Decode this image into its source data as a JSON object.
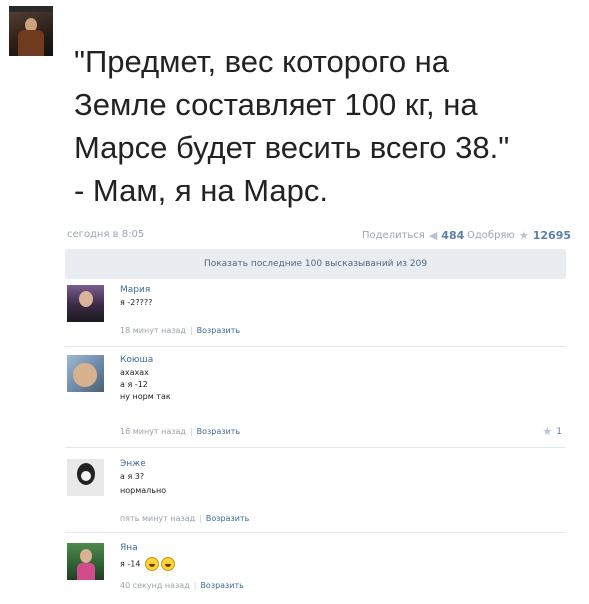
{
  "post": {
    "lines": [
      "\"Предмет, вес которого на",
      "Земле составляет 100 кг, на",
      "Марсе будет весить всего 38.\"",
      "- Мам, я на Марс."
    ],
    "date": "сегодня в 8:05",
    "share_label": "Поделиться",
    "share_count": "484",
    "like_label": "Одобряю",
    "like_count": "12695"
  },
  "show_more": "Показать последние 100 высказываний из 209",
  "comments": [
    {
      "name": "Мария",
      "lines": [
        "я -2????"
      ],
      "time": "18 минут назад",
      "reply": "Возразить"
    },
    {
      "name": "Коюша",
      "lines": [
        "ахахах",
        "а я -12",
        "ну норм так"
      ],
      "time": "16 минут назад",
      "reply": "Возразить",
      "likes": "1"
    },
    {
      "name": "Энже",
      "lines": [
        "а я 3?",
        "нормально"
      ],
      "time": "пять минут назад",
      "reply": "Возразить"
    },
    {
      "name": "Яна",
      "lines": [
        "я -14"
      ],
      "time": "40 секунд назад",
      "reply": "Возразить"
    }
  ]
}
